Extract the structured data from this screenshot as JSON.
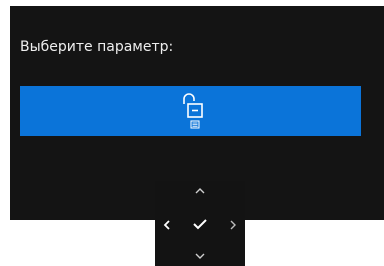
{
  "osd": {
    "prompt": "Выберите параметр:",
    "option_icon": "padlock-unlocked-icon",
    "accent_color": "#0b74d9",
    "background_color": "#141414"
  },
  "joystick": {
    "icons": [
      "chevron-up-icon",
      "chevron-left-icon",
      "checkmark-icon",
      "chevron-right-icon",
      "chevron-down-icon"
    ]
  }
}
